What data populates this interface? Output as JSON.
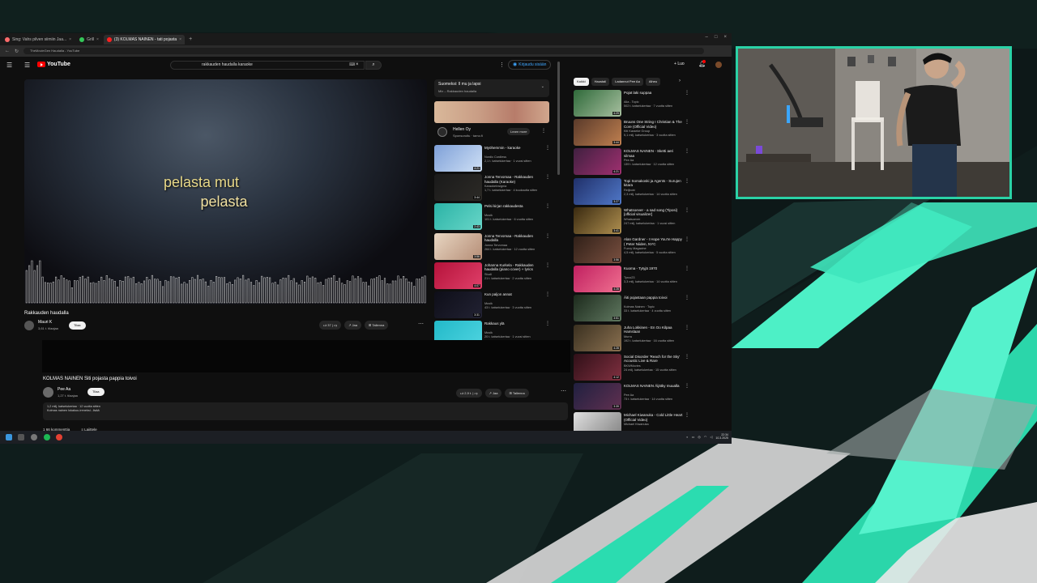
{
  "browser": {
    "tabs": [
      {
        "label": "Sing: Vahs pilven siimiin Jaa...",
        "favicon": "#ff6b6b",
        "active": false
      },
      {
        "label": "Grill",
        "favicon": "#34c759",
        "active": false
      },
      {
        "label": "(3) KOLMAS NAINEN - tati pojasta",
        "favicon": "#ff2020",
        "active": true
      }
    ],
    "address": "TheMovieGen Haudalla - YouTube"
  },
  "youtube": {
    "logo_text": "YouTube",
    "search_value": "rakkauden haudalla karaoke",
    "signin_label": "Kirjaudu sisään",
    "create_label": "Luo",
    "player": {
      "lyric_line1": "pelasta mut",
      "lyric_line2": "pelasta"
    },
    "video": {
      "title": "Rakkauden haudalla",
      "channel": "Mauri K",
      "subs": "3,61 t. tilaajaa",
      "subscribe_label": "Tilaa",
      "likes": "37",
      "share_label": "Jaa",
      "save_label": "Tallenna"
    },
    "upnext": {
      "title": "Suomeksi: Il mu ja lapsi",
      "subtitle": "Mix – Rakkauden haudalla"
    },
    "ad": {
      "name": "Hellen Oy",
      "sponsored": "Sponsoroitu · tamo.fi",
      "button": "Learn more"
    },
    "recs": [
      {
        "title": "Myöhemmin - karaoke",
        "channel": "Nordic Cordless",
        "meta": "2,1 t. katselukertaa · 1 vuosi sitten",
        "dur": "4:21",
        "colors": [
          "#7ea0d8",
          "#cfe0f5"
        ]
      },
      {
        "title": "Jonna Tervomaa - Rakkauden haudalla (Karaoke)",
        "channel": "KaraokeInsignia",
        "meta": "1,7 t. katselukertaa · 4 kuukautta sitten",
        "dur": "3:44",
        "colors": [
          "#1a1a1a",
          "#2c2a26"
        ]
      },
      {
        "title": "Pelsi kirjan rakkaudesta",
        "channel": "Musik",
        "meta": "101 t. katselukertaa · 6 vuotta sitten",
        "dur": "2:43",
        "colors": [
          "#2bb3a6",
          "#68d6c8"
        ]
      },
      {
        "title": "Jonna Tervomaa - Rakkauden haudalla",
        "channel": "Jonna Tervomaa",
        "meta": "264 t. katselukertaa · 12 vuotta sitten",
        "dur": "3:56",
        "colors": [
          "#e8d6c2",
          "#b58d76"
        ]
      },
      {
        "title": "Johanna Kurkela - Rakkauden haudalla (piano cover) + lyrics",
        "channel": "Studi",
        "meta": "21 t. katselukertaa · 2 vuotta sitten",
        "dur": "4:07",
        "colors": [
          "#b5123a",
          "#e0406a"
        ]
      },
      {
        "title": "Kun paljon annat",
        "channel": "Musik",
        "meta": "43 t. katselukertaa · 3 vuotta sitten",
        "dur": "3:31",
        "colors": [
          "#0e0e18",
          "#223"
        ]
      },
      {
        "title": "Rakkaus ylä",
        "channel": "Musik",
        "meta": "20 t. katselukertaa · 1 vuosi sitten",
        "dur": "3:12",
        "colors": [
          "#22b9c8",
          "#4fd4e0"
        ]
      }
    ],
    "video2": {
      "title": "KOLMAS NAINEN Siti pojasta pappia toivoi",
      "channel": "Pee Aa",
      "subs": "1,27 t. tilaajaa",
      "subscribe_label": "Tilaa",
      "likes": "2,9 t.",
      "share_label": "Jaa",
      "save_label": "Tallenna",
      "desc_line1": "1,2 milj. katselukertaa · 12 vuotta sitten",
      "desc_line2": "Kolmas nainen lokakuu-ireneksi...lisää",
      "comments_count": "1 66 kommenttia",
      "sort_label": "Lajittele"
    },
    "chips": [
      "Kaikki",
      "Haustali",
      "Ladannut Pee Aa",
      "Aiheu"
    ],
    "right_recs": [
      {
        "title": "Pojat laki suppaa",
        "channel": "Aila - Topic",
        "meta": "502 t. katselukertaa · 7 vuotta sitten",
        "dur": "4:29",
        "colors": [
          "#2f6a3a",
          "#a8c0a0"
        ]
      },
      {
        "title": "Bruuns One String I Christian & The Core (Official Video)",
        "channel": "Kiti Karaeke Group",
        "meta": "5,1 milj. katselukertaa · 3 vuotta sitten",
        "dur": "3:44",
        "colors": [
          "#5a3a2a",
          "#c08050"
        ]
      },
      {
        "title": "KOLMAS NAINEN - Sketti aeri silmaa",
        "channel": "Pee Aa",
        "meta": "139 t. katselukertaa · 12 vuotta sitten",
        "dur": "4:21",
        "colors": [
          "#402040",
          "#a03070"
        ]
      },
      {
        "title": "Topi Sorsakoski ja Agents - Surujen kitara",
        "channel": "Reijbobi",
        "meta": "2,3 milj. katselukertaa · 14 vuotta sitten",
        "dur": "3:27",
        "colors": [
          "#20306a",
          "#5078c8"
        ]
      },
      {
        "title": "Whatsoever - a sad song (Tiposi) [official visualizer]",
        "channel": "Whatsoever",
        "meta": "247 milj. katselukertaa · 1 vuosi sitten",
        "dur": "3:41",
        "colors": [
          "#3a2a10",
          "#b09050"
        ]
      },
      {
        "title": "Alan Gardner - I Hope You're Happy ( Peter Niiden, NYC",
        "channel": "Fuzzy Magazine",
        "meta": "4,5 milj. katselukertaa · 5 vuotta sitten",
        "dur": "3:56",
        "colors": [
          "#302018",
          "#7a5040"
        ]
      },
      {
        "title": "Kuoma - Tytyjä 1970",
        "channel": "Tyrco23",
        "meta": "3,3 milj. katselukertaa · 14 vuotta sitten",
        "dur": "4:28",
        "colors": [
          "#c02060",
          "#f07090"
        ]
      },
      {
        "title": "Äiti pojastaan pappia toivoi",
        "channel": "Kolmas Nainen · Topic",
        "meta": "33 t. katselukertaa · 4 vuotta sitten",
        "dur": "3:51",
        "colors": [
          "#1c2a1c",
          "#607860"
        ]
      },
      {
        "title": "Juha Lokkinen - En Oo Kilpaa Hamslaan",
        "channel": "Murra",
        "meta": "192 t. katselukertaa · 16 vuotta sitten",
        "dur": "4:28",
        "colors": [
          "#3a3020",
          "#8a7050"
        ]
      },
      {
        "title": "Social Disorder 'Reach for the Sky' Acoustic Live & Rare",
        "channel": "BKWMovies",
        "meta": "24 milj. katselukertaa · 15 vuotta sitten",
        "dur": "4:12",
        "colors": [
          "#301018",
          "#803040"
        ]
      },
      {
        "title": "KOLMAS NAINEN Äijätky muualla",
        "channel": "Pee Aa",
        "meta": "73 t. katselukertaa · 14 vuotta sitten",
        "dur": "3:39",
        "colors": [
          "#202040",
          "#603050"
        ]
      },
      {
        "title": "Michael Kiwanuka - Cold Little Heart (Official Video)",
        "channel": "Michael Kiwanuka",
        "meta": "",
        "dur": "",
        "colors": [
          "#e0e0e0",
          "#808080"
        ]
      }
    ]
  },
  "taskbar": {
    "time": "22:34",
    "date": "10.3.2025"
  }
}
